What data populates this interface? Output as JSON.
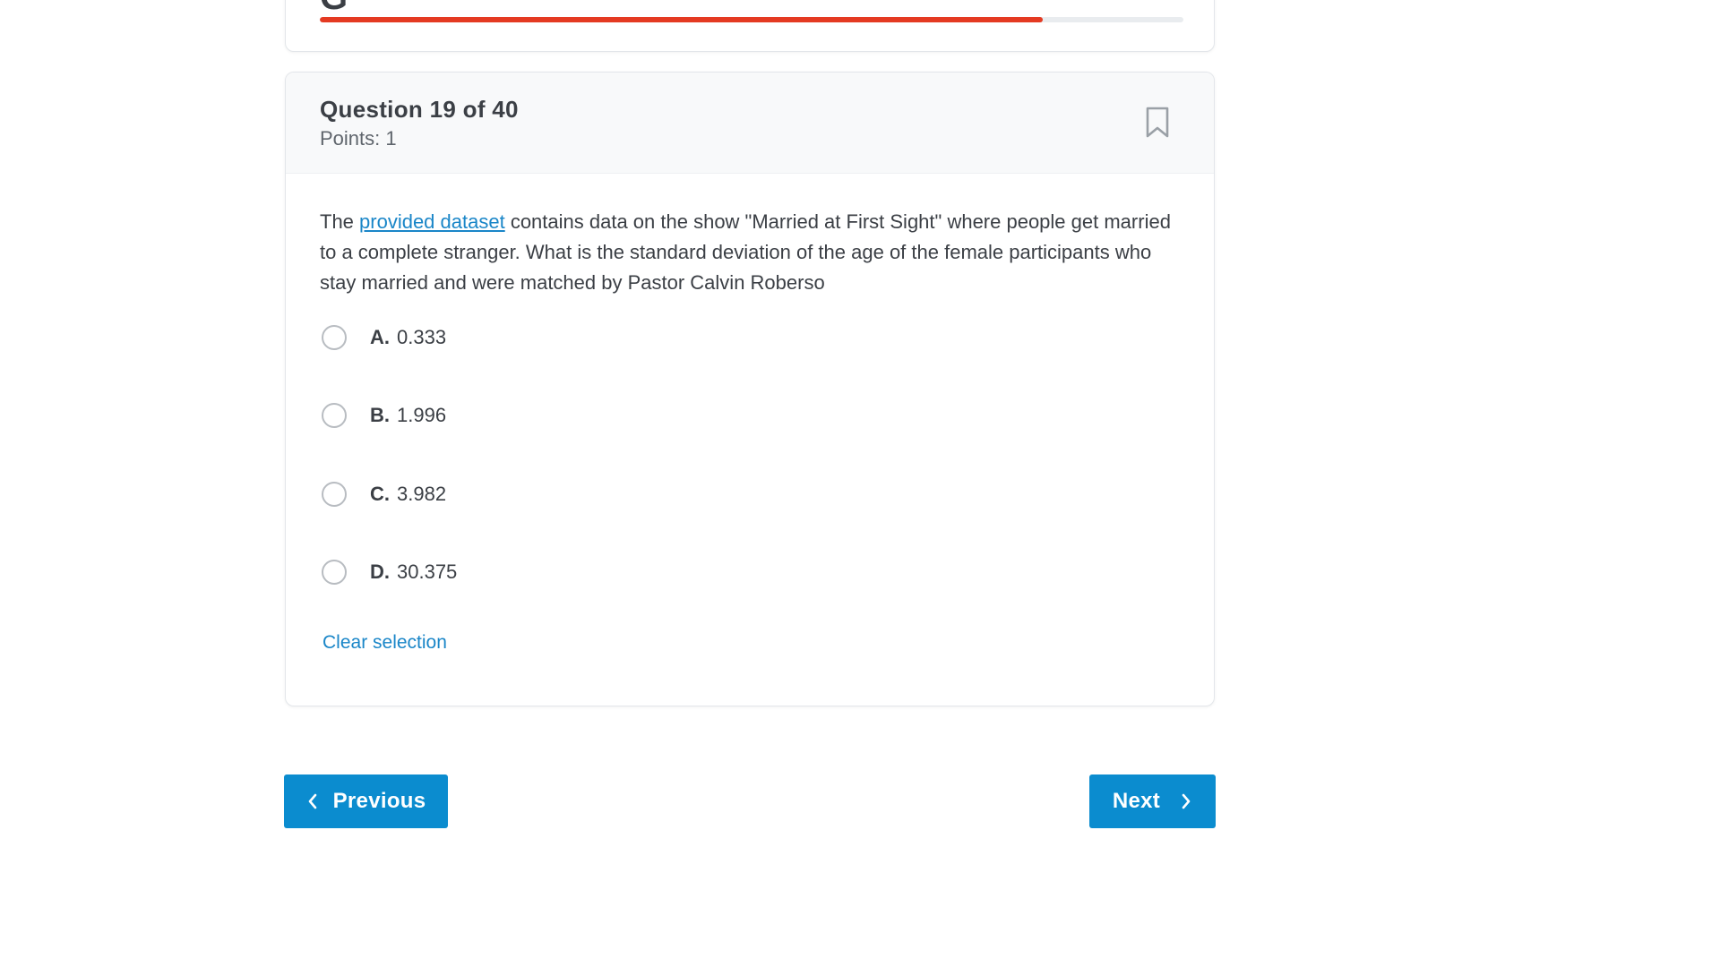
{
  "progress": {
    "fraction": 0.837,
    "glyph": "G"
  },
  "question": {
    "title": "Question 19 of 40",
    "points": "Points: 1",
    "text_before_link": "The ",
    "link_text": "provided dataset",
    "text_after_link": " contains data on the show \"Married at First Sight\" where people get married to a complete stranger. What is the standard deviation of the age of the female participants who stay married and were matched by Pastor Calvin Roberso",
    "options": [
      {
        "letter": "A.",
        "value": "0.333"
      },
      {
        "letter": "B.",
        "value": "1.996"
      },
      {
        "letter": "C.",
        "value": "3.982"
      },
      {
        "letter": "D.",
        "value": "30.375"
      }
    ],
    "clear_label": "Clear selection",
    "bookmark_icon": "bookmark-icon"
  },
  "navigation": {
    "previous_label": "Previous",
    "next_label": "Next"
  },
  "colors": {
    "accent": "#0b8ccf",
    "link": "#1a86c8",
    "progress_fill": "#e43a22",
    "progress_track": "#e9ecef"
  }
}
